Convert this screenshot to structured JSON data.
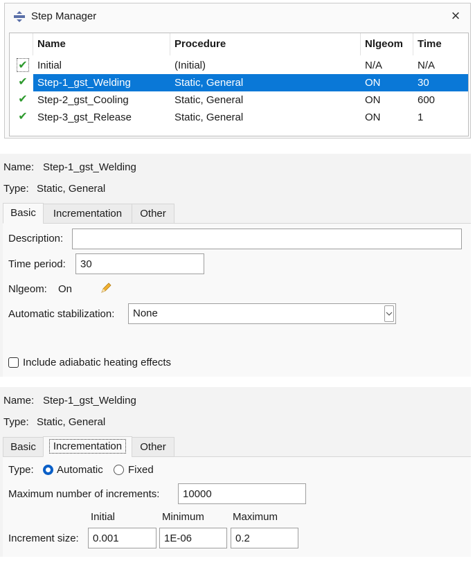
{
  "step_manager": {
    "title": "Step Manager",
    "close_glyph": "×",
    "columns": [
      "Name",
      "Procedure",
      "Nlgeom",
      "Time"
    ],
    "check_glyph": "✔",
    "selected_row": 1,
    "rows": [
      {
        "name": "Initial",
        "procedure": "(Initial)",
        "nlgeom": "N/A",
        "time": "N/A"
      },
      {
        "name": "Step-1_gst_Welding",
        "procedure": "Static, General",
        "nlgeom": "ON",
        "time": "30"
      },
      {
        "name": "Step-2_gst_Cooling",
        "procedure": "Static, General",
        "nlgeom": "ON",
        "time": "600"
      },
      {
        "name": "Step-3_gst_Release",
        "procedure": "Static, General",
        "nlgeom": "ON",
        "time": "1"
      }
    ]
  },
  "basic_panel": {
    "name_label": "Name:",
    "name_value": "Step-1_gst_Welding",
    "type_label": "Type:",
    "type_value": "Static, General",
    "tabs": [
      "Basic",
      "Incrementation",
      "Other"
    ],
    "active_tab": "Basic",
    "description_label": "Description:",
    "description_value": "",
    "time_period_label": "Time period:",
    "time_period_value": "30",
    "nlgeom_label": "Nlgeom:",
    "nlgeom_value": "On",
    "stabilization_label": "Automatic stabilization:",
    "stabilization_value": "None",
    "adiabatic_label": "Include adiabatic heating effects",
    "adiabatic_checked": false
  },
  "incrementation_panel": {
    "name_label": "Name:",
    "name_value": "Step-1_gst_Welding",
    "type_label": "Type:",
    "type_value": "Static, General",
    "tabs": [
      "Basic",
      "Incrementation",
      "Other"
    ],
    "active_tab": "Incrementation",
    "inc_type_label": "Type:",
    "inc_type_options": [
      "Automatic",
      "Fixed"
    ],
    "inc_type_selected": "Automatic",
    "max_increments_label": "Maximum number of increments:",
    "max_increments_value": "10000",
    "size_headers": [
      "Initial",
      "Minimum",
      "Maximum"
    ],
    "increment_size_label": "Increment size:",
    "initial_value": "0.001",
    "minimum_value": "1E-06",
    "maximum_value": "0.2"
  },
  "colors": {
    "selection": "#0a78d7",
    "check": "#2e9a2e",
    "radio": "#0a5fc7"
  }
}
